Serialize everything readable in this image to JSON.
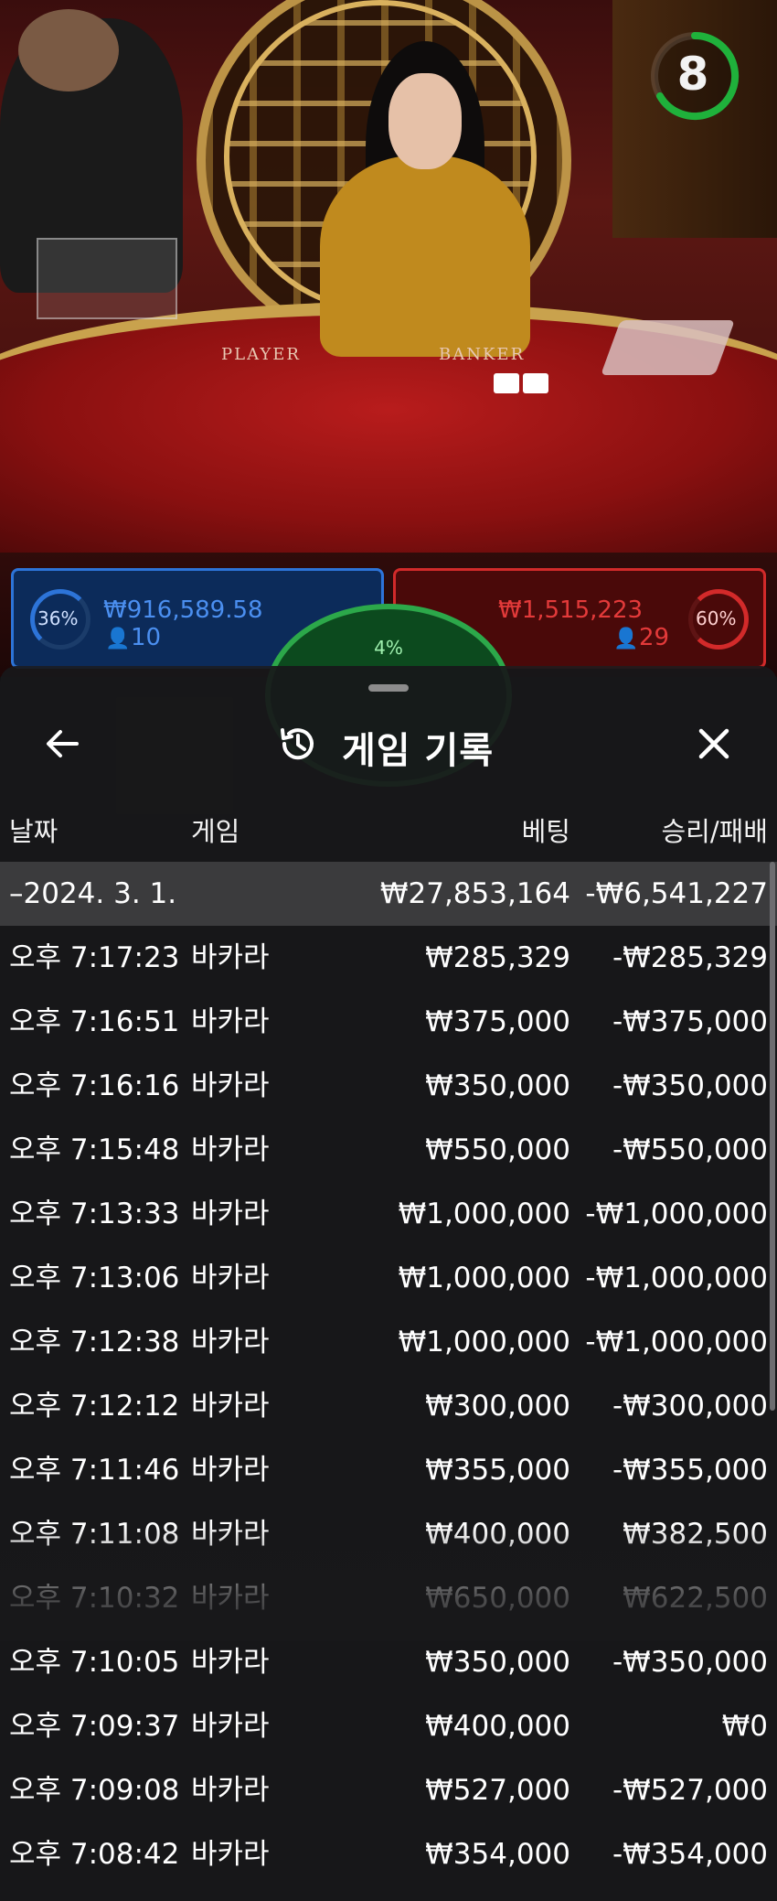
{
  "scene": {
    "table_player_label": "PLAYER",
    "table_banker_label": "BANKER",
    "timer": "8"
  },
  "betting": {
    "player": {
      "percent": "36%",
      "amount": "₩916,589.58",
      "players": "10",
      "color": "#2d74d8"
    },
    "banker": {
      "percent": "60%",
      "amount": "₩1,515,223",
      "players": "29",
      "color": "#d22a2a"
    },
    "tie": {
      "percent": "4%",
      "color": "#2ca84a"
    }
  },
  "sheet": {
    "title": "게임 기록",
    "back_icon": "arrow-left-icon",
    "history_icon": "history-icon",
    "close_icon": "close-icon",
    "columns": {
      "date": "날짜",
      "game": "게임",
      "bet": "베팅",
      "result": "승리/패배"
    },
    "summary": {
      "date": "–2024. 3. 1.",
      "bet": "₩27,853,164",
      "result": "-₩6,541,227"
    },
    "rows": [
      {
        "time": "오후 7:17:23",
        "game": "바카라",
        "bet": "₩285,329",
        "result": "-₩285,329"
      },
      {
        "time": "오후 7:16:51",
        "game": "바카라",
        "bet": "₩375,000",
        "result": "-₩375,000"
      },
      {
        "time": "오후 7:16:16",
        "game": "바카라",
        "bet": "₩350,000",
        "result": "-₩350,000"
      },
      {
        "time": "오후 7:15:48",
        "game": "바카라",
        "bet": "₩550,000",
        "result": "-₩550,000"
      },
      {
        "time": "오후 7:13:33",
        "game": "바카라",
        "bet": "₩1,000,000",
        "result": "-₩1,000,000"
      },
      {
        "time": "오후 7:13:06",
        "game": "바카라",
        "bet": "₩1,000,000",
        "result": "-₩1,000,000"
      },
      {
        "time": "오후 7:12:38",
        "game": "바카라",
        "bet": "₩1,000,000",
        "result": "-₩1,000,000"
      },
      {
        "time": "오후 7:12:12",
        "game": "바카라",
        "bet": "₩300,000",
        "result": "-₩300,000"
      },
      {
        "time": "오후 7:11:46",
        "game": "바카라",
        "bet": "₩355,000",
        "result": "-₩355,000"
      },
      {
        "time": "오후 7:11:08",
        "game": "바카라",
        "bet": "₩400,000",
        "result": "₩382,500"
      },
      {
        "time": "오후 7:10:32",
        "game": "바카라",
        "bet": "₩650,000",
        "result": "₩622,500"
      },
      {
        "time": "오후 7:10:05",
        "game": "바카라",
        "bet": "₩350,000",
        "result": "-₩350,000"
      },
      {
        "time": "오후 7:09:37",
        "game": "바카라",
        "bet": "₩400,000",
        "result": "₩0"
      },
      {
        "time": "오후 7:09:08",
        "game": "바카라",
        "bet": "₩527,000",
        "result": "-₩527,000"
      },
      {
        "time": "오후 7:08:42",
        "game": "바카라",
        "bet": "₩354,000",
        "result": "-₩354,000"
      }
    ]
  }
}
